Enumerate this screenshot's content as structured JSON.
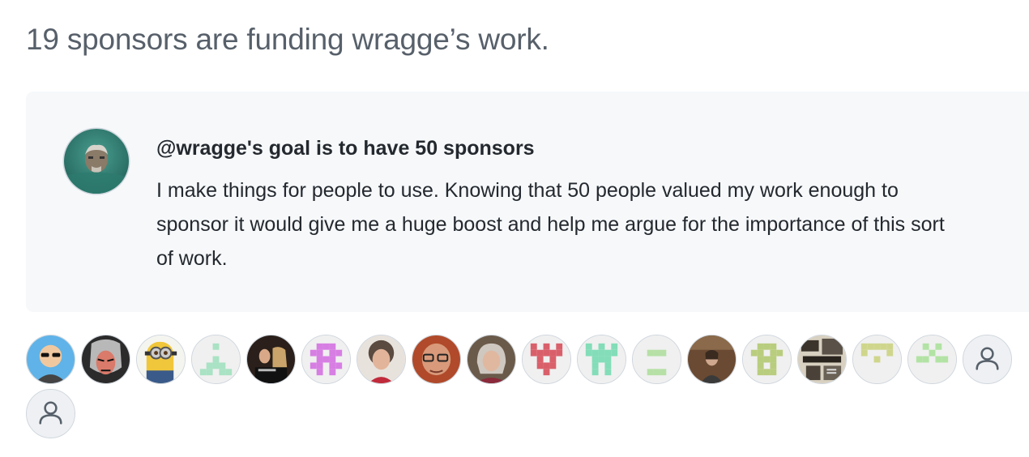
{
  "heading": "19 sponsors are funding wragge’s work.",
  "goal": {
    "title": "@wragge's goal is to have 50 sponsors",
    "description": "I make things for people to use. Knowing that 50 people valued my work enough to sponsor it would give me a huge boost and help me argue for the importance of this sort of work.",
    "avatar_icon": "user-photo-avatar"
  },
  "sponsors": [
    {
      "kind": "photo",
      "icon": "cartoon-sunglasses-avatar",
      "bg": "#5fb3e8"
    },
    {
      "kind": "photo",
      "icon": "comic-villain-avatar",
      "bg": "#3a3a3a"
    },
    {
      "kind": "photo",
      "icon": "minion-avatar",
      "bg": "#e8c75a"
    },
    {
      "kind": "identicon",
      "icon": "identicon-green",
      "color": "#a9e2c4",
      "pattern": [
        [
          0,
          0,
          1,
          0,
          0
        ],
        [
          0,
          0,
          0,
          0,
          0
        ],
        [
          0,
          0,
          1,
          0,
          0
        ],
        [
          0,
          1,
          1,
          1,
          0
        ],
        [
          1,
          1,
          0,
          1,
          1
        ]
      ]
    },
    {
      "kind": "photo",
      "icon": "band-photo-avatar",
      "bg": "#2a1f1a"
    },
    {
      "kind": "identicon",
      "icon": "identicon-magenta",
      "color": "#d77ee3",
      "pattern": [
        [
          0,
          1,
          1,
          1,
          0
        ],
        [
          1,
          1,
          0,
          1,
          1
        ],
        [
          0,
          1,
          1,
          1,
          0
        ],
        [
          1,
          1,
          0,
          1,
          1
        ],
        [
          0,
          1,
          0,
          1,
          0
        ]
      ]
    },
    {
      "kind": "photo",
      "icon": "woman-curly-hair-avatar",
      "bg": "#7a6a5a"
    },
    {
      "kind": "photo",
      "icon": "man-glasses-avatar",
      "bg": "#a0522d"
    },
    {
      "kind": "photo",
      "icon": "woman-grey-hair-avatar",
      "bg": "#8a7a6a"
    },
    {
      "kind": "identicon",
      "icon": "identicon-red",
      "color": "#d9606b",
      "pattern": [
        [
          1,
          0,
          1,
          0,
          1
        ],
        [
          1,
          1,
          1,
          1,
          1
        ],
        [
          0,
          1,
          0,
          1,
          0
        ],
        [
          0,
          1,
          1,
          1,
          0
        ],
        [
          0,
          0,
          1,
          0,
          0
        ]
      ]
    },
    {
      "kind": "identicon",
      "icon": "identicon-mint",
      "color": "#83ddb8",
      "pattern": [
        [
          1,
          0,
          1,
          0,
          1
        ],
        [
          1,
          1,
          1,
          1,
          1
        ],
        [
          0,
          1,
          1,
          1,
          0
        ],
        [
          0,
          1,
          0,
          1,
          0
        ],
        [
          0,
          1,
          0,
          1,
          0
        ]
      ]
    },
    {
      "kind": "identicon",
      "icon": "identicon-lightgreen",
      "color": "#b6e0a6",
      "pattern": [
        [
          0,
          0,
          0,
          0,
          0
        ],
        [
          0,
          1,
          1,
          1,
          0
        ],
        [
          0,
          0,
          0,
          0,
          0
        ],
        [
          0,
          0,
          0,
          0,
          0
        ],
        [
          0,
          1,
          1,
          1,
          0
        ]
      ]
    },
    {
      "kind": "photo",
      "icon": "person-library-avatar",
      "bg": "#5a4030"
    },
    {
      "kind": "identicon",
      "icon": "identicon-olive",
      "color": "#b9cd7e",
      "pattern": [
        [
          0,
          1,
          1,
          1,
          0
        ],
        [
          1,
          1,
          0,
          1,
          1
        ],
        [
          0,
          1,
          1,
          1,
          0
        ],
        [
          0,
          1,
          0,
          1,
          0
        ],
        [
          0,
          1,
          1,
          1,
          0
        ]
      ]
    },
    {
      "kind": "photo",
      "icon": "newspaper-collage-avatar",
      "bg": "#3a342c"
    },
    {
      "kind": "identicon",
      "icon": "identicon-khaki",
      "color": "#cfd68c",
      "pattern": [
        [
          1,
          1,
          1,
          1,
          1
        ],
        [
          1,
          0,
          0,
          0,
          1
        ],
        [
          0,
          0,
          1,
          0,
          0
        ],
        [
          0,
          0,
          0,
          0,
          0
        ],
        [
          0,
          0,
          0,
          0,
          0
        ]
      ]
    },
    {
      "kind": "identicon",
      "icon": "identicon-palegreen",
      "color": "#b2e3a4",
      "pattern": [
        [
          0,
          1,
          0,
          1,
          0
        ],
        [
          0,
          0,
          1,
          0,
          0
        ],
        [
          1,
          1,
          0,
          1,
          1
        ],
        [
          0,
          0,
          0,
          0,
          0
        ],
        [
          0,
          0,
          0,
          0,
          0
        ]
      ]
    },
    {
      "kind": "default",
      "icon": "person-outline-icon"
    },
    {
      "kind": "default",
      "icon": "person-outline-icon"
    }
  ]
}
